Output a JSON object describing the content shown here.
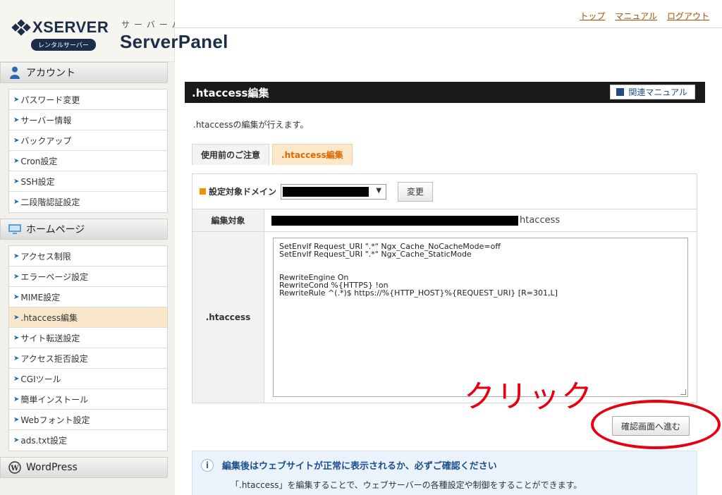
{
  "header": {
    "brand_name": "XSERVER",
    "brand_badge": "レンタルサーバー",
    "product_kana": "サーバーパネル",
    "product_name": "ServerPanel",
    "links": [
      "トップ",
      "マニュアル",
      "ログアウト"
    ]
  },
  "sidebar": {
    "account": {
      "title": "アカウント",
      "items": [
        "パスワード変更",
        "サーバー情報",
        "バックアップ",
        "Cron設定",
        "SSH設定",
        "二段階認証設定"
      ]
    },
    "homepage": {
      "title": "ホームページ",
      "items": [
        "アクセス制限",
        "エラーページ設定",
        "MIME設定",
        ".htaccess編集",
        "サイト転送設定",
        "アクセス拒否設定",
        "CGIツール",
        "簡単インストール",
        "Webフォント設定",
        "ads.txt設定"
      ],
      "active": ".htaccess編集"
    },
    "wordpress": {
      "title": "WordPress"
    }
  },
  "main": {
    "title": ".htaccess編集",
    "manual_button": "関連マニュアル",
    "description": ".htaccessの編集が行えます。",
    "tabs": [
      "使用前のご注意",
      ".htaccess編集"
    ],
    "active_tab": ".htaccess編集",
    "domain_label": "設定対象ドメイン",
    "change_button": "変更",
    "target_label": "編集対象",
    "target_suffix": "htaccess",
    "htaccess_label": ".htaccess",
    "htaccess_lines": [
      "SetEnvIf Request_URI \".*\" Ngx_Cache_NoCacheMode=off",
      "SetEnvIf Request_URI \".*\" Ngx_Cache_StaticMode",
      "",
      "",
      "RewriteEngine On",
      "RewriteCond %{HTTPS} !on",
      "RewriteRule ^(.*)$ https://%{HTTP_HOST}%{REQUEST_URI} [R=301,L]"
    ],
    "confirm_button": "確認画面へ進む",
    "annotation": "クリック",
    "info_title": "編集後はウェブサイトが正常に表示されるか、必ずご確認ください",
    "info_body": "「.htaccess」を編集することで、ウェブサーバーの各種設定や制御をすることができます。"
  },
  "colors": {
    "accent_orange": "#f39200",
    "annotation_red": "#e60012",
    "brand_navy": "#1c2d4a"
  }
}
